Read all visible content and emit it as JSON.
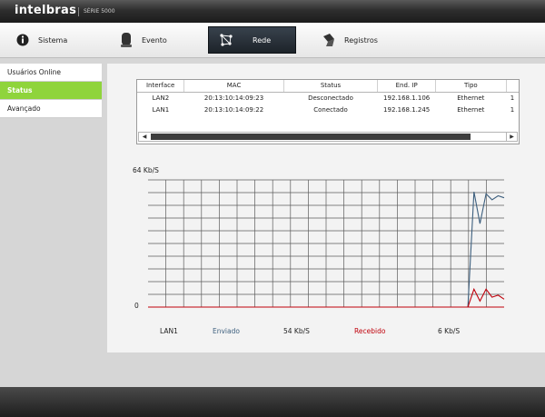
{
  "header": {
    "brand": "intelbras",
    "series": "SÉRIE 5000"
  },
  "nav": {
    "tabs": [
      {
        "label": "Sistema",
        "icon": "info-icon",
        "active": false
      },
      {
        "label": "Evento",
        "icon": "camera-icon",
        "active": false
      },
      {
        "label": "Rede",
        "icon": "network-icon",
        "active": true
      },
      {
        "label": "Registros",
        "icon": "log-icon",
        "active": false
      }
    ]
  },
  "sidebar": {
    "items": [
      {
        "label": "Usuários Online",
        "active": false
      },
      {
        "label": "Status",
        "active": true
      },
      {
        "label": "Avançado",
        "active": false
      }
    ]
  },
  "table": {
    "columns": [
      "Interface",
      "MAC",
      "Status",
      "End. IP",
      "Tipo",
      ""
    ],
    "rows": [
      [
        "LAN2",
        "20:13:10:14:09:23",
        "Desconectado",
        "192.168.1.106",
        "Ethernet",
        "1"
      ],
      [
        "LAN1",
        "20:13:10:14:09:22",
        "Conectado",
        "192.168.1.245",
        "Ethernet",
        "1"
      ]
    ],
    "scroll_left_icon": "◀",
    "scroll_right_icon": "▶"
  },
  "chart_data": {
    "type": "line",
    "y_max_label": "64 Kb/S",
    "y_min_label": "0",
    "ylim": [
      0,
      64
    ],
    "grid": true,
    "x": [
      0,
      1,
      2,
      3,
      4,
      5,
      6,
      7,
      8,
      9,
      10,
      11,
      12,
      13,
      14,
      15,
      16,
      17,
      18,
      19,
      20,
      21,
      22,
      23,
      24,
      25,
      26,
      27,
      28,
      29,
      30,
      31,
      32,
      33,
      34,
      35,
      36,
      37,
      38,
      39,
      40,
      41,
      42,
      43,
      44,
      45,
      46,
      47,
      48,
      49,
      50,
      51,
      52,
      53,
      54,
      55,
      56,
      57,
      58,
      59
    ],
    "series": [
      {
        "name": "Enviado",
        "color": "#3d5f7e",
        "values": [
          0,
          0,
          0,
          0,
          0,
          0,
          0,
          0,
          0,
          0,
          0,
          0,
          0,
          0,
          0,
          0,
          0,
          0,
          0,
          0,
          0,
          0,
          0,
          0,
          0,
          0,
          0,
          0,
          0,
          0,
          0,
          0,
          0,
          0,
          0,
          0,
          0,
          0,
          0,
          0,
          0,
          0,
          0,
          0,
          0,
          0,
          0,
          0,
          0,
          0,
          0,
          0,
          0,
          0,
          58,
          42,
          57,
          54,
          56,
          55
        ]
      },
      {
        "name": "Recebido",
        "color": "#c0000b",
        "values": [
          0,
          0,
          0,
          0,
          0,
          0,
          0,
          0,
          0,
          0,
          0,
          0,
          0,
          0,
          0,
          0,
          0,
          0,
          0,
          0,
          0,
          0,
          0,
          0,
          0,
          0,
          0,
          0,
          0,
          0,
          0,
          0,
          0,
          0,
          0,
          0,
          0,
          0,
          0,
          0,
          0,
          0,
          0,
          0,
          0,
          0,
          0,
          0,
          0,
          0,
          0,
          0,
          0,
          0,
          9,
          3,
          9,
          5,
          6,
          4
        ]
      }
    ],
    "legend": {
      "interface": "LAN1",
      "sent_label": "Enviado",
      "sent_value": "54 Kb/S",
      "received_label": "Recebido",
      "received_value": "6 Kb/S"
    }
  },
  "colors": {
    "accent": "#8fd43c",
    "sent": "#3d5f7e",
    "received": "#c0000b"
  }
}
